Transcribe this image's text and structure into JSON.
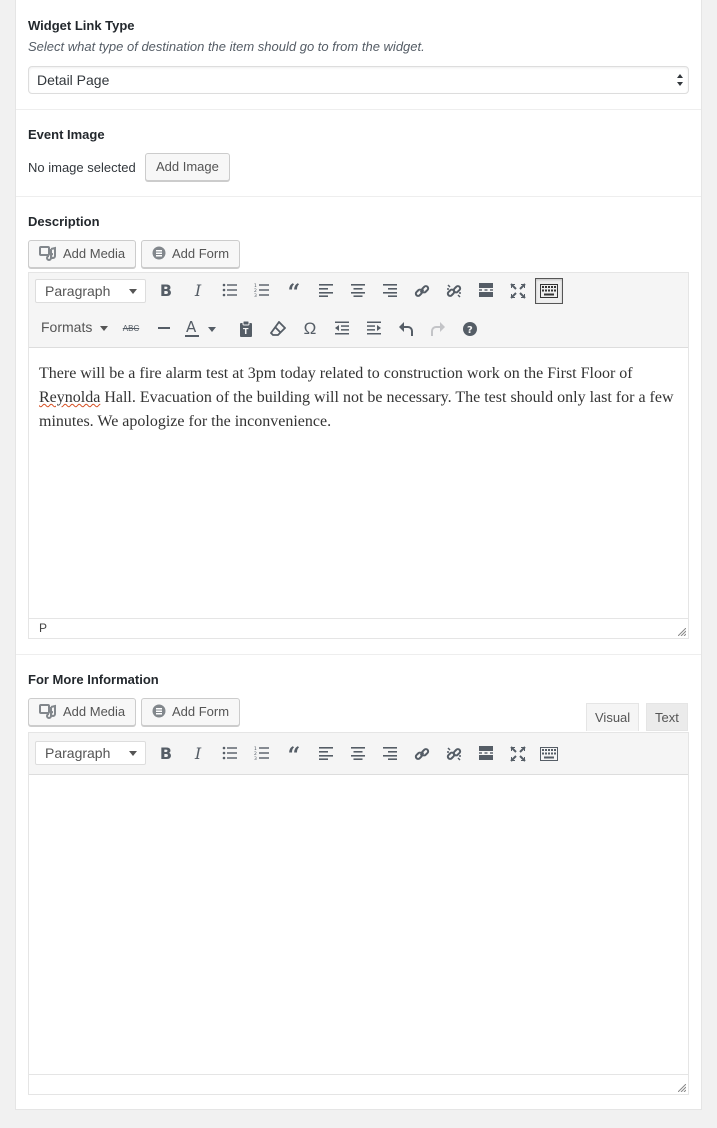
{
  "widget_link_type": {
    "label": "Widget Link Type",
    "description": "Select what type of destination the item should go to from the widget.",
    "selected": "Detail Page"
  },
  "event_image": {
    "label": "Event Image",
    "status": "No image selected",
    "add_button": "Add Image"
  },
  "description": {
    "label": "Description",
    "add_media": "Add Media",
    "add_form": "Add Form",
    "format_select": "Paragraph",
    "formats_menu": "Formats",
    "content_before_spell": "There will be a fire alarm test at 3pm today related to construction work on the First Floor of ",
    "content_spell": "Reynolda",
    "content_after_spell": " Hall. Evacuation of the building will not be necessary. The test should only last for a few minutes. We apologize for the inconvenience.",
    "path": "P",
    "toolbar_row1": [
      "bold-icon",
      "italic-icon",
      "bullet-list-icon",
      "numbered-list-icon",
      "blockquote-icon",
      "align-left-icon",
      "align-center-icon",
      "align-right-icon",
      "link-icon",
      "unlink-icon",
      "read-more-icon",
      "fullscreen-icon",
      "toolbar-toggle-icon"
    ],
    "toolbar_row2": [
      "strikethrough-icon",
      "horizontal-line-icon",
      "text-color-icon",
      "paste-text-icon",
      "clear-formatting-icon",
      "special-character-icon",
      "outdent-icon",
      "indent-icon",
      "undo-icon",
      "redo-icon",
      "help-icon"
    ]
  },
  "more_info": {
    "label": "For More Information",
    "add_media": "Add Media",
    "add_form": "Add Form",
    "tab_visual": "Visual",
    "tab_text": "Text",
    "format_select": "Paragraph",
    "content": ""
  },
  "colors": {
    "background": "#f1f1f1",
    "panel": "#ffffff",
    "toolbar": "#f5f5f5",
    "icon": "#555d66",
    "spellcheck": "#d54e21"
  }
}
